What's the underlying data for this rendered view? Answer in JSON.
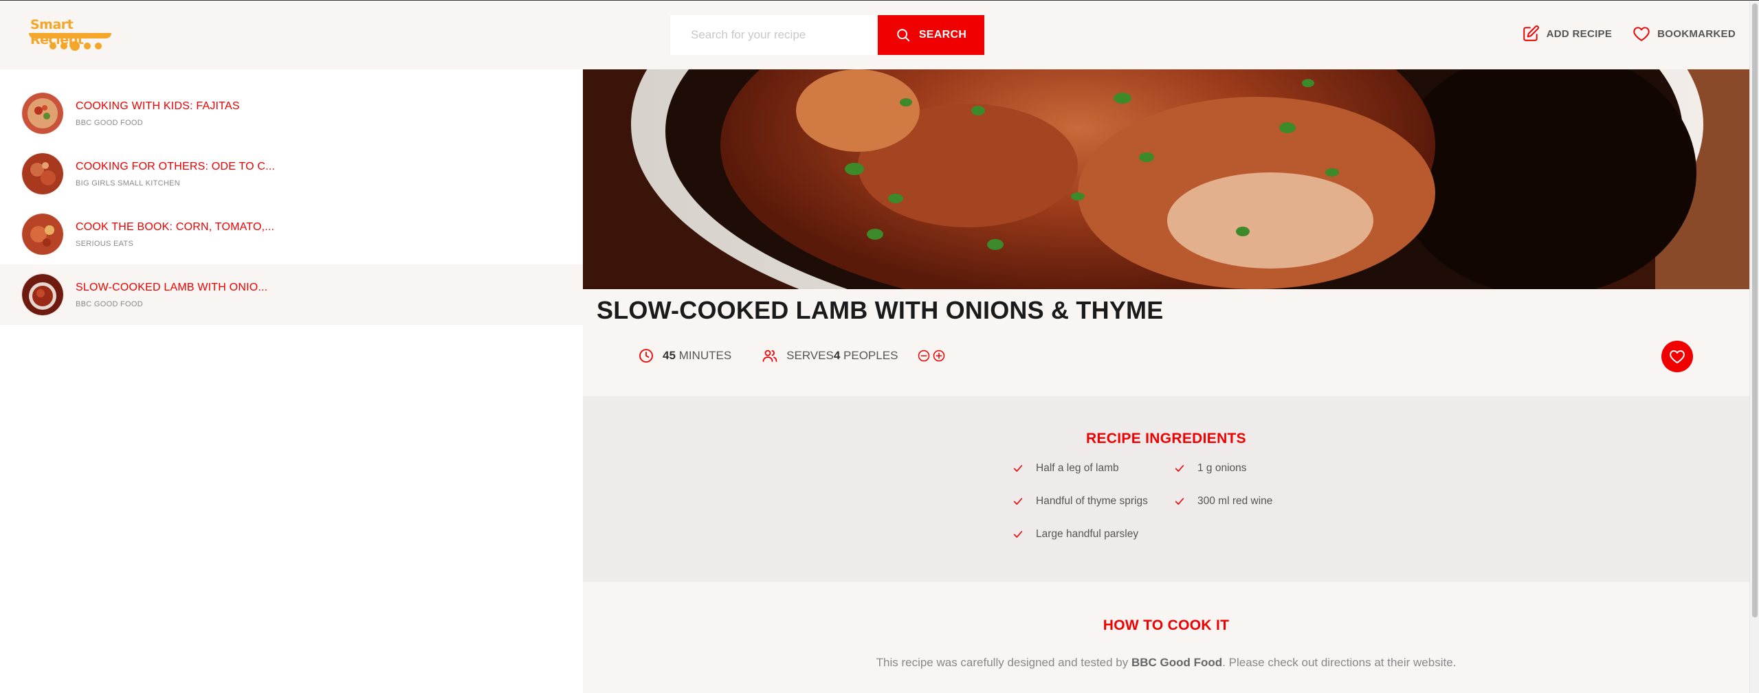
{
  "header": {
    "logo_text": "Smart Reciept",
    "search_placeholder": "Search for your recipe",
    "search_button": "SEARCH",
    "nav": {
      "add_recipe": "ADD RECIPE",
      "bookmarked": "BOOKMARKED"
    }
  },
  "results": [
    {
      "title": "COOKING WITH KIDS: FAJITAS",
      "publisher": "BBC GOOD FOOD",
      "active": false
    },
    {
      "title": "COOKING FOR OTHERS: ODE TO C...",
      "publisher": "BIG GIRLS SMALL KITCHEN",
      "active": false
    },
    {
      "title": "COOK THE BOOK: CORN, TOMATO,...",
      "publisher": "SERIOUS EATS",
      "active": false
    },
    {
      "title": "SLOW-COOKED LAMB WITH ONIO...",
      "publisher": "BBC GOOD FOOD",
      "active": true
    }
  ],
  "recipe": {
    "title": "SLOW-COOKED LAMB WITH ONIONS & THYME",
    "cooking_time": "45",
    "cooking_time_unit": "MINUTES",
    "servings_prefix": "SERVES",
    "servings": "4",
    "servings_unit": "PEOPLES",
    "ingredients_title": "RECIPE INGREDIENTS",
    "ingredients": [
      "Half a leg of lamb",
      "1 g onions",
      "Handful of thyme sprigs",
      "300 ml red wine",
      "Large handful parsley"
    ],
    "howto_title": "HOW TO COOK IT",
    "howto_prefix": "This recipe was carefully designed and tested by",
    "howto_publisher": "BBC Good Food",
    "howto_suffix": ". Please check out directions at their website."
  },
  "colors": {
    "accent": "#f00000",
    "logo": "#f4a62a",
    "header_bg": "#f8f5f3",
    "ingredients_bg": "#eeebea"
  }
}
